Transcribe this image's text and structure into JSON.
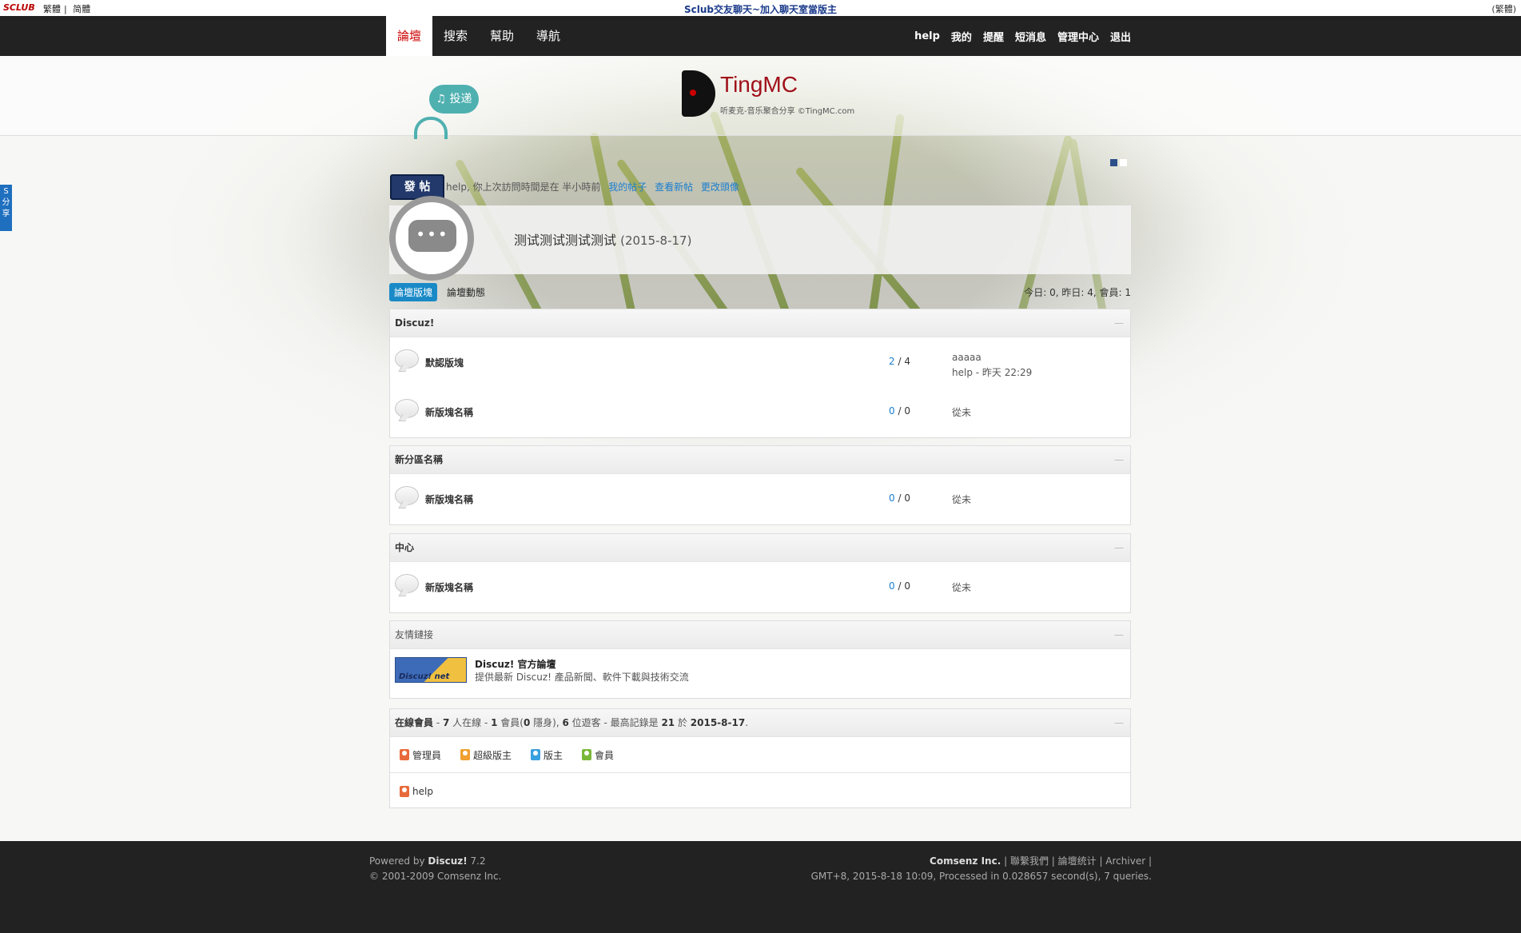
{
  "topbar": {
    "logo": "SCLUB",
    "lang_trad": "繁體",
    "lang_sep": "|",
    "lang_simp": "简體",
    "center": "Sclub交友聊天~加入聊天室當版主",
    "right": "(繁體)"
  },
  "nav": {
    "left": [
      "論壇",
      "搜索",
      "幫助",
      "導航"
    ],
    "right": [
      "help",
      "我的",
      "提醒",
      "短消息",
      "管理中心",
      "退出"
    ]
  },
  "brand": {
    "name": "TingMC",
    "sub": "听麦克-音乐聚合分享 ©TingMC.com",
    "submit_label": "♫ 投递"
  },
  "share_tab": "S 分享",
  "post": {
    "button": "發 帖",
    "welcome": "help, 你上次訪問時間是在 半小時前",
    "links": [
      "我的帖子",
      "查看新帖",
      "更改頭像"
    ]
  },
  "announce": {
    "text": "测试测试测试测试",
    "date": "(2015-8-17)",
    "bubble": "•••"
  },
  "tabs": [
    "論壇版塊",
    "論壇動態"
  ],
  "stats_top": "今日: 0, 昨日: 4, 會員: 1",
  "categories": [
    {
      "name": "Discuz!",
      "forums": [
        {
          "name": "默認版塊",
          "topics": "2",
          "posts": "4",
          "last_title": "aaaaa",
          "last_by": "help - 昨天 22:29"
        },
        {
          "name": "新版塊名稱",
          "topics": "0",
          "posts": "0",
          "last": "從未"
        }
      ]
    },
    {
      "name": "新分區名稱",
      "forums": [
        {
          "name": "新版塊名稱",
          "topics": "0",
          "posts": "0",
          "last": "從未"
        }
      ]
    },
    {
      "name": "中心",
      "forums": [
        {
          "name": "新版塊名稱",
          "topics": "0",
          "posts": "0",
          "last": "從未"
        }
      ]
    }
  ],
  "count_sep": " / ",
  "links_box": {
    "head": "友情鏈接",
    "logo": "Discuz! net",
    "title": "Discuz! 官方論壇",
    "desc": "提供最新 Discuz! 產品新聞、軟件下載與技術交流"
  },
  "online": {
    "label": "在線會員",
    "sep1": " - ",
    "total": "7",
    "text1": " 人在線 - ",
    "members": "1",
    "text2": " 會員(",
    "hidden": "0",
    "text3": " 隱身), ",
    "guests": "6",
    "text4": " 位遊客 - 最高記錄是 ",
    "record": "21",
    "text5": " 於 ",
    "record_date": "2015-8-17",
    "text6": ".",
    "legend": [
      "管理員",
      "超級版主",
      "版主",
      "會員"
    ],
    "users": [
      "help"
    ]
  },
  "footer": {
    "powered_prefix": "Powered by ",
    "product": "Discuz!",
    "version": " 7.2",
    "copyright": "© 2001-2009 Comsenz Inc.",
    "company": "Comsenz Inc.",
    "links": " | 聯繫我們 | 論壇统计 | Archiver |",
    "status": "GMT+8, 2015-8-18 10:09, Processed in 0.028657 second(s), 7 queries."
  },
  "colors": {
    "nav_bg": "#222222",
    "active_tab": "#c00000",
    "link_blue": "#1a7ed0",
    "brand_red": "#a0101a",
    "post_button": "#23396b"
  }
}
